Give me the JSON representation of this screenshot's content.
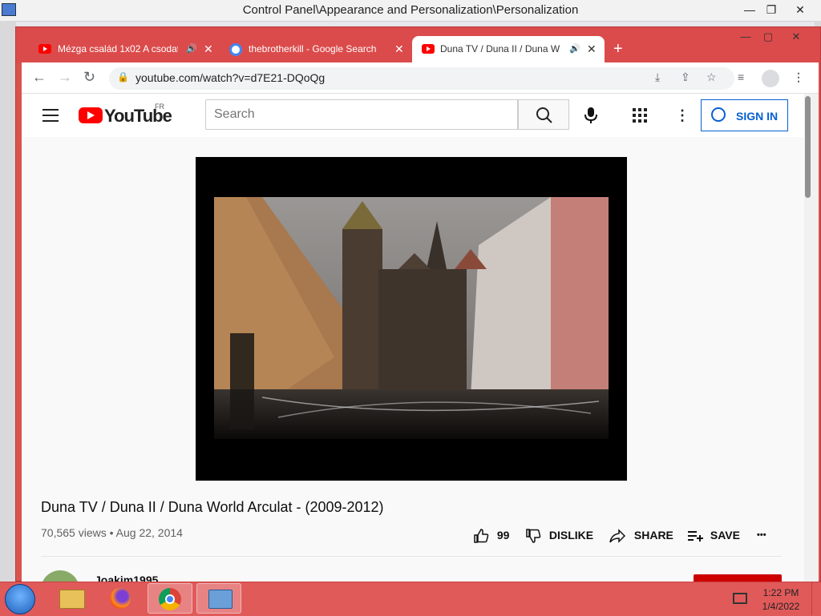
{
  "control_panel": {
    "title": "Control Panel\\Appearance and Personalization\\Personalization",
    "minimize": "—",
    "maximize": "❐",
    "close": "✕"
  },
  "browser": {
    "tabs": [
      {
        "title": "Mézga család 1x02 A csodat",
        "favicon": "youtube-icon",
        "audio": true,
        "active": false
      },
      {
        "title": "thebrotherkill - Google Search",
        "favicon": "google-icon",
        "audio": false,
        "active": false
      },
      {
        "title": "Duna TV / Duna II / Duna W",
        "favicon": "youtube-icon",
        "audio": true,
        "active": true
      }
    ],
    "new_tab": "+",
    "url": "youtube.com/watch?v=d7E21-DQoQg",
    "window_minimize": "—",
    "window_maximize": "▢",
    "window_close": "✕"
  },
  "youtube": {
    "logo_text": "YouTube",
    "country_code": "FR",
    "search_placeholder": "Search",
    "sign_in": "SIGN IN"
  },
  "video": {
    "title": "Duna TV / Duna II / Duna World Arculat - (2009-2012)",
    "views": "70,565 views",
    "date": "Aug 22, 2014",
    "likes": "99",
    "dislike_label": "DISLIKE",
    "share_label": "SHARE",
    "save_label": "SAVE",
    "more": "•••"
  },
  "channel": {
    "name": "Joakim1995"
  },
  "taskbar": {
    "time": "1:22 PM",
    "date": "1/4/2022"
  },
  "colors": {
    "accent_red": "#db4b4b",
    "youtube_red": "#ff0000",
    "signin_blue": "#065fd4"
  }
}
